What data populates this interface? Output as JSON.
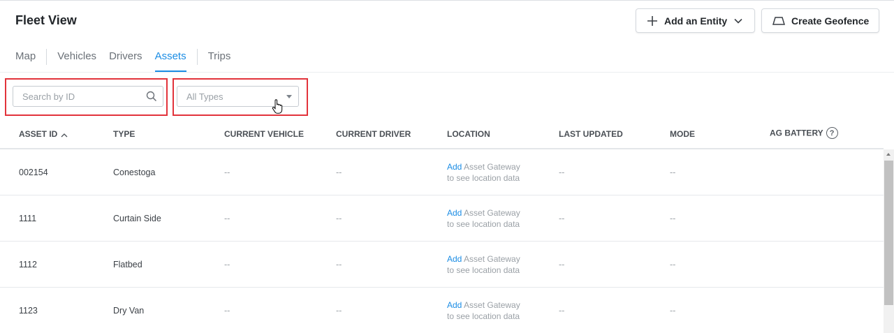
{
  "page": {
    "title": "Fleet View"
  },
  "header": {
    "add_entity_label": "Add an Entity",
    "create_geofence_label": "Create Geofence"
  },
  "tabs": [
    {
      "label": "Map"
    },
    {
      "label": "Vehicles"
    },
    {
      "label": "Drivers"
    },
    {
      "label": "Assets",
      "active": true
    },
    {
      "label": "Trips"
    }
  ],
  "filters": {
    "search_placeholder": "Search by ID",
    "type_selected": "All Types"
  },
  "table": {
    "columns": [
      "ASSET ID",
      "TYPE",
      "CURRENT VEHICLE",
      "CURRENT DRIVER",
      "LOCATION",
      "LAST UPDATED",
      "MODE",
      "AG BATTERY"
    ],
    "sort_column": "ASSET ID",
    "sort_direction": "ascending",
    "help_glyph": "?",
    "location_link": "Add",
    "location_rest": "Asset Gateway",
    "location_line2": "to see location data",
    "rows": [
      {
        "asset_id": "002154",
        "type": "Conestoga",
        "current_vehicle": "--",
        "current_driver": "--",
        "last_updated": "--",
        "mode": "--"
      },
      {
        "asset_id": "1111",
        "type": "Curtain Side",
        "current_vehicle": "--",
        "current_driver": "--",
        "last_updated": "--",
        "mode": "--"
      },
      {
        "asset_id": "1112",
        "type": "Flatbed",
        "current_vehicle": "--",
        "current_driver": "--",
        "last_updated": "--",
        "mode": "--"
      },
      {
        "asset_id": "1123",
        "type": "Dry Van",
        "current_vehicle": "--",
        "current_driver": "--",
        "last_updated": "--",
        "mode": "--"
      }
    ]
  },
  "colors": {
    "accent": "#1a8ce4",
    "highlight": "#e2333b",
    "text": "#2b2f33",
    "muted": "#9aa0a6"
  },
  "icons": {
    "add_entity": "plus-icon",
    "add_entity_menu": "chevron-down-icon",
    "geofence": "geofence-icon",
    "search": "search-icon",
    "type_dropdown": "caret-down-icon",
    "sort": "sort-ascending-icon",
    "help": "help-circle-icon",
    "cursor": "hand-pointer-icon"
  }
}
